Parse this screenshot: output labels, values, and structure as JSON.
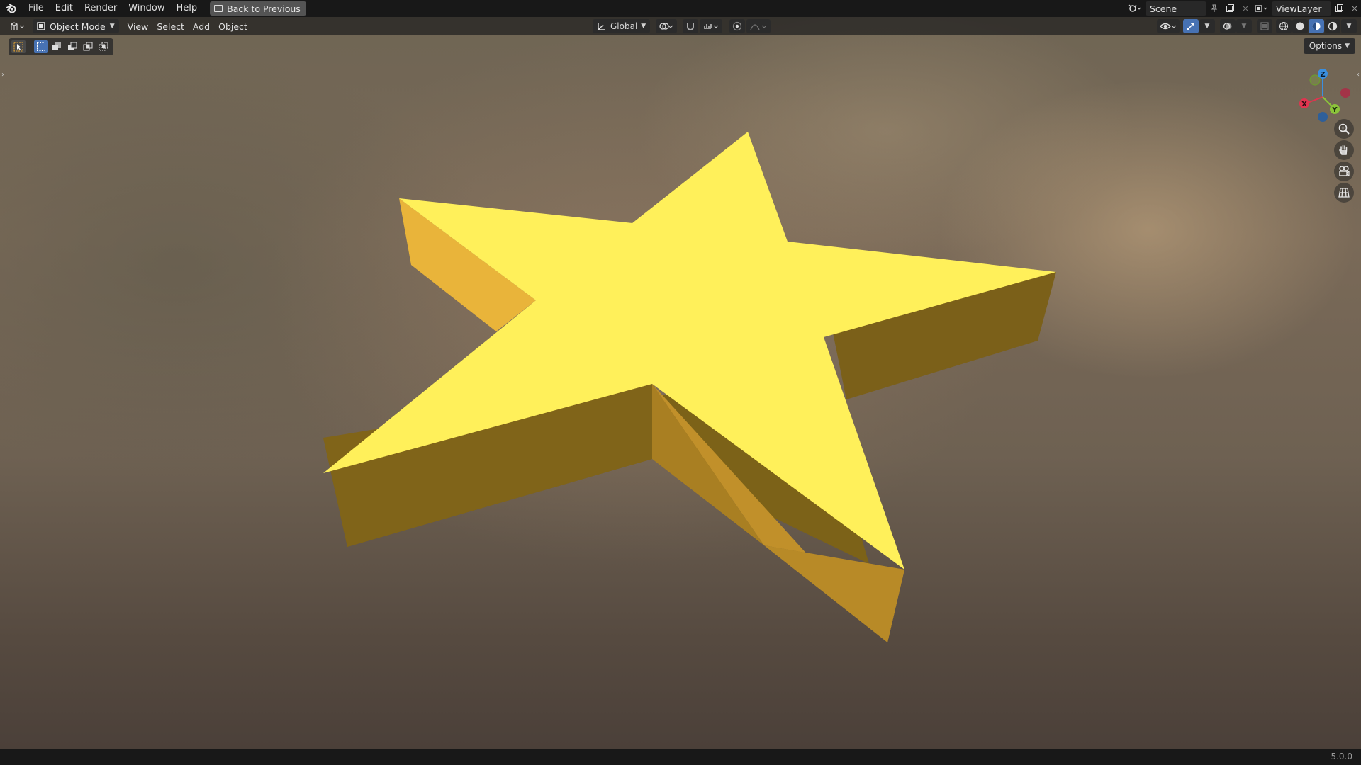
{
  "menubar": {
    "logo_icon": "blender-logo-icon",
    "items": [
      {
        "label": "File"
      },
      {
        "label": "Edit"
      },
      {
        "label": "Render"
      },
      {
        "label": "Window"
      },
      {
        "label": "Help"
      }
    ],
    "back_button": "Back to Previous",
    "scene_name": "Scene",
    "view_layer_name": "ViewLayer"
  },
  "viewport_header": {
    "mode": "Object Mode",
    "menus": [
      {
        "label": "View"
      },
      {
        "label": "Select"
      },
      {
        "label": "Add"
      },
      {
        "label": "Object"
      }
    ],
    "transform_orientation": "Global",
    "options_label": "Options"
  },
  "gizmo": {
    "axes": {
      "x": "X",
      "y": "Y",
      "z": "Z"
    },
    "axis_colors": {
      "x": "#e0344f",
      "y": "#8bc43a",
      "z": "#3a8fe0"
    }
  },
  "scene": {
    "object": "star",
    "face_colors": {
      "top": "#fff05a",
      "side_dark": "#7f6418",
      "side_mid": "#c1902a",
      "side_light": "#e9b43a"
    }
  },
  "statusbar": {
    "version": "5.0.0"
  }
}
